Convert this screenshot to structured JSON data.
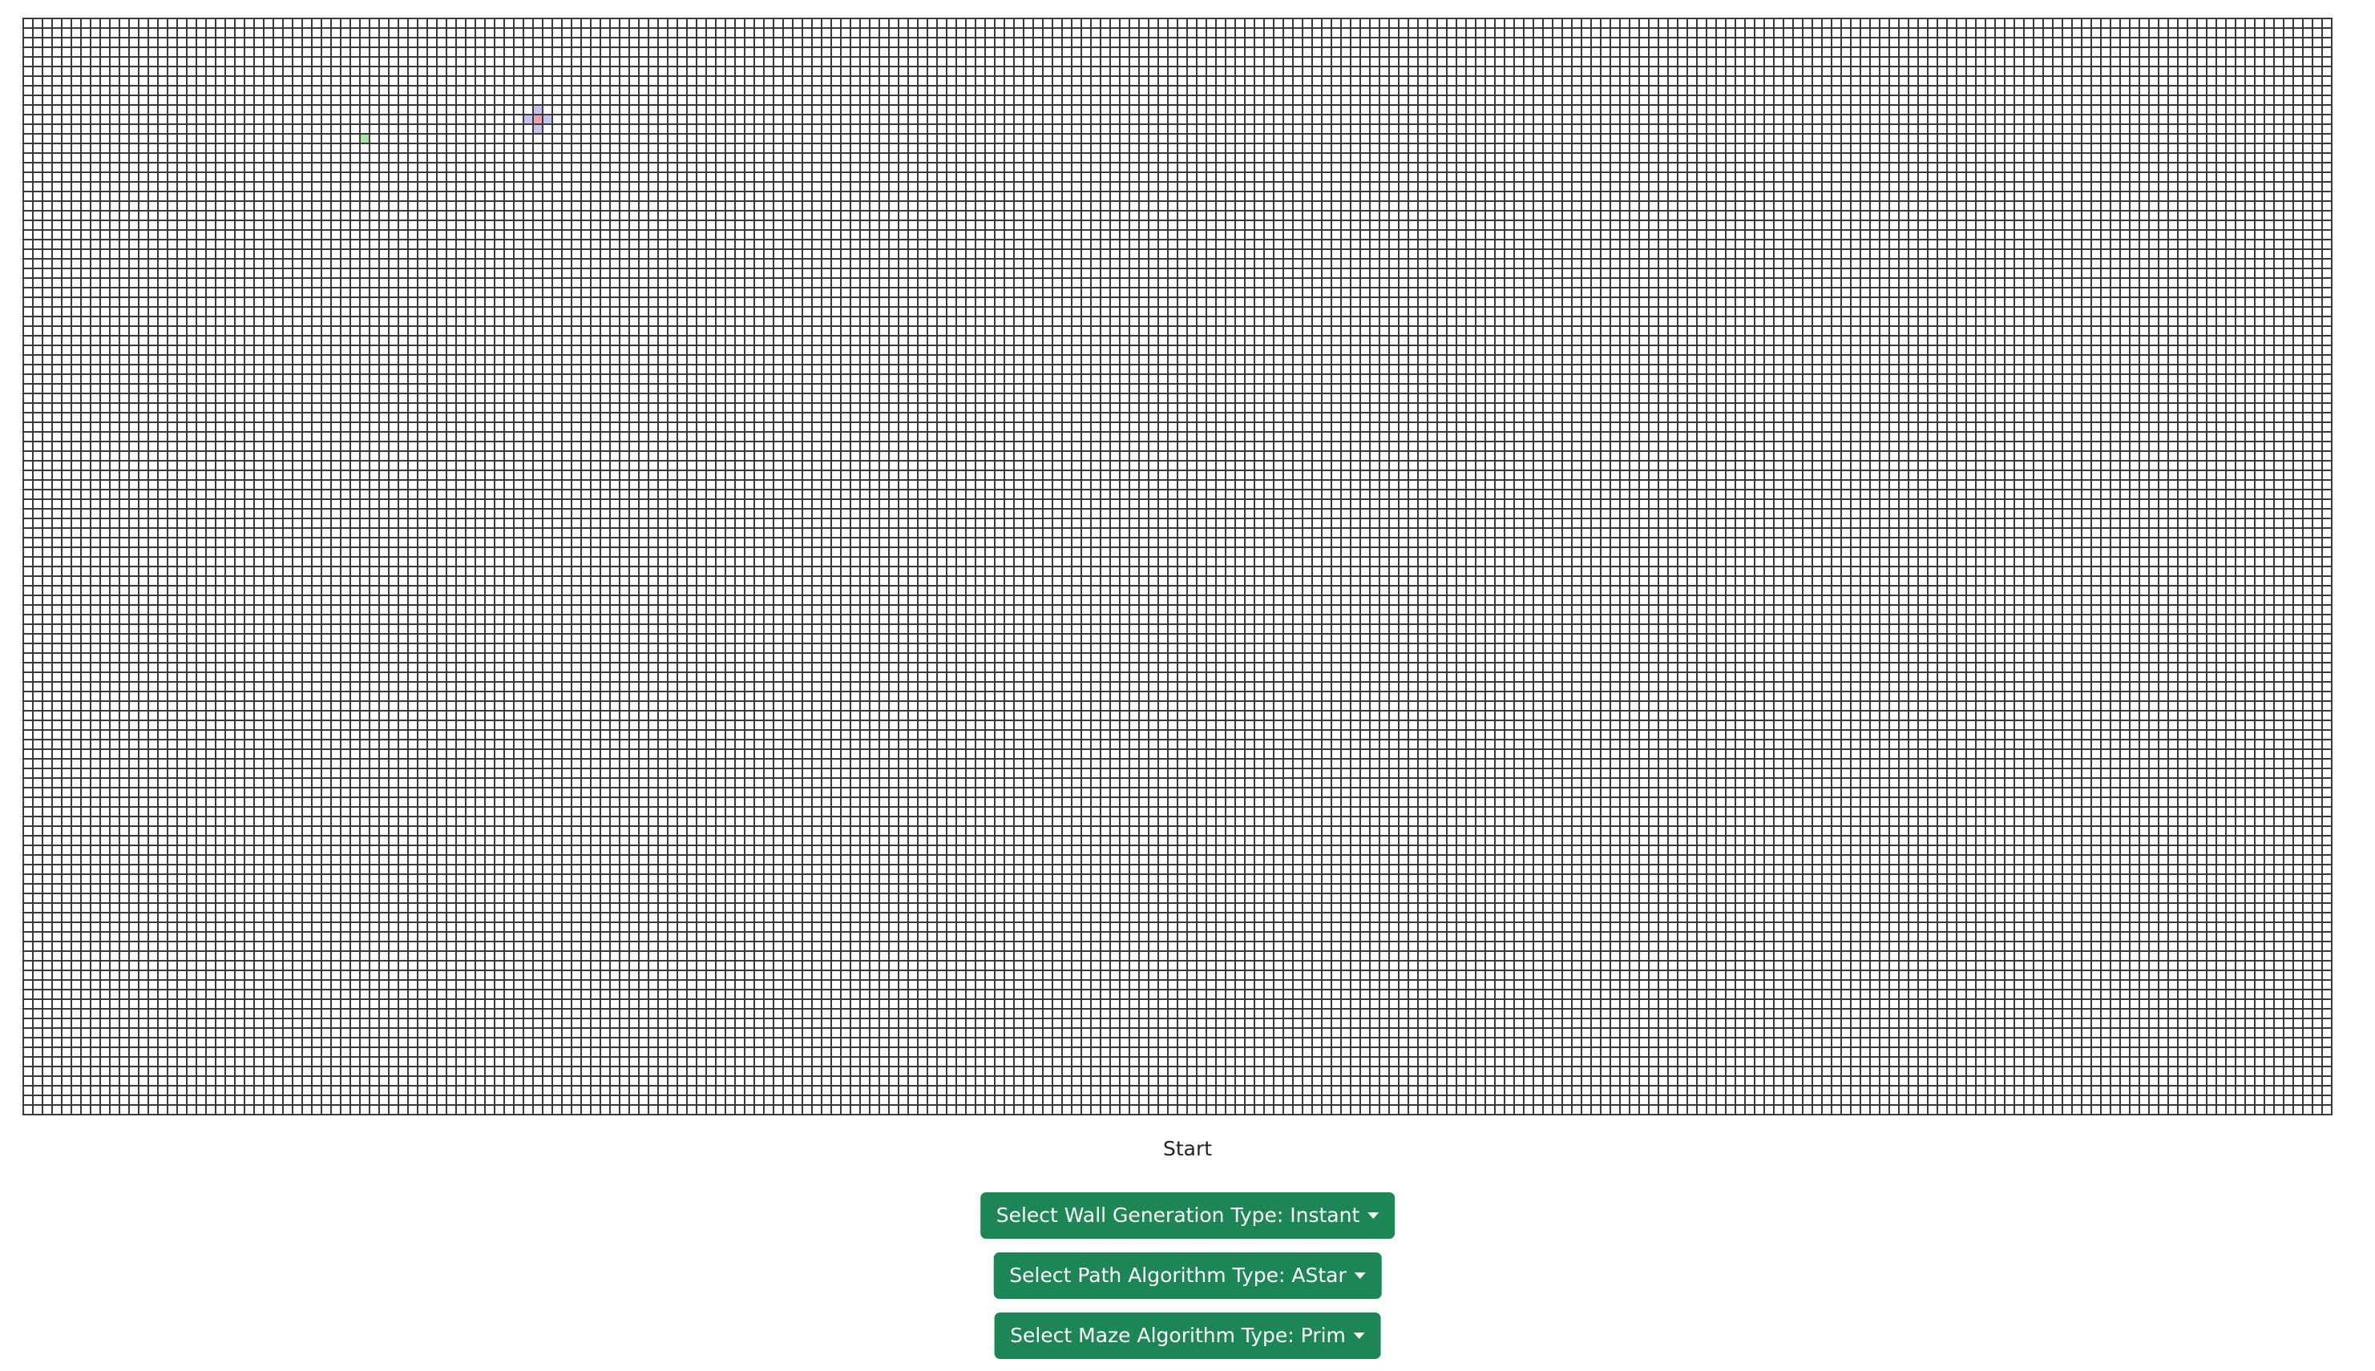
{
  "start": {
    "label": "Start"
  },
  "controls": {
    "wall_generation_label": "Select Wall Generation Type: Instant",
    "path_algorithm_label": "Select Path Algorithm Type: AStar",
    "maze_algorithm_label": "Select Maze Algorithm Type: Prim"
  },
  "grid": {
    "columns": 240,
    "rows": 114,
    "start_node": {
      "col": 35,
      "row": 12
    },
    "end_node": {
      "col": 53,
      "row": 10
    },
    "visited_cells": [
      {
        "col": 53,
        "row": 9
      },
      {
        "col": 52,
        "row": 10
      },
      {
        "col": 54,
        "row": 10
      },
      {
        "col": 53,
        "row": 11
      }
    ]
  },
  "colors": {
    "button_bg": "#1c8755",
    "grid_line": "#3a3a3a",
    "start_node": "#a8e6a8",
    "end_node": "#e8a0b0",
    "visited": "#c4c4f0"
  }
}
